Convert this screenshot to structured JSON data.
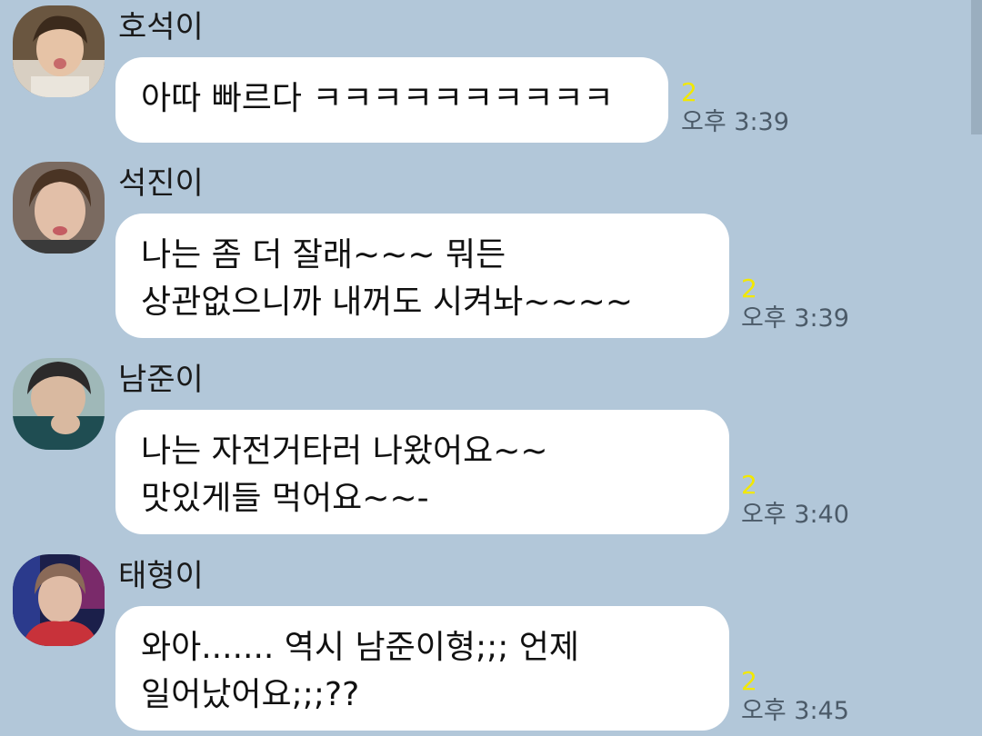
{
  "colors": {
    "background": "#b2c7d9",
    "bubble": "#ffffff",
    "unread": "#f2e800",
    "time": "#4b5a68"
  },
  "messages": [
    {
      "sender": "호석이",
      "lines": [
        "아따 빠르다 ㅋㅋㅋㅋㅋㅋㅋㅋㅋㅋ"
      ],
      "unread": "2",
      "time": "오후 3:39",
      "avatar_icon": "profile-photo"
    },
    {
      "sender": "석진이",
      "lines": [
        "나는 좀 더 잘래~~~ 뭐든",
        "상관없으니까 내꺼도 시켜놔~~~~"
      ],
      "unread": "2",
      "time": "오후 3:39",
      "avatar_icon": "profile-photo"
    },
    {
      "sender": "남준이",
      "lines": [
        "나는 자전거타러 나왔어요~~",
        "맛있게들 먹어요~~-"
      ],
      "unread": "2",
      "time": "오후 3:40",
      "avatar_icon": "profile-photo"
    },
    {
      "sender": "태형이",
      "lines": [
        "와아....... 역시 남준이형;;; 언제",
        "일어났어요;;;??"
      ],
      "unread": "2",
      "time": "오후 3:45",
      "avatar_icon": "profile-photo"
    }
  ]
}
